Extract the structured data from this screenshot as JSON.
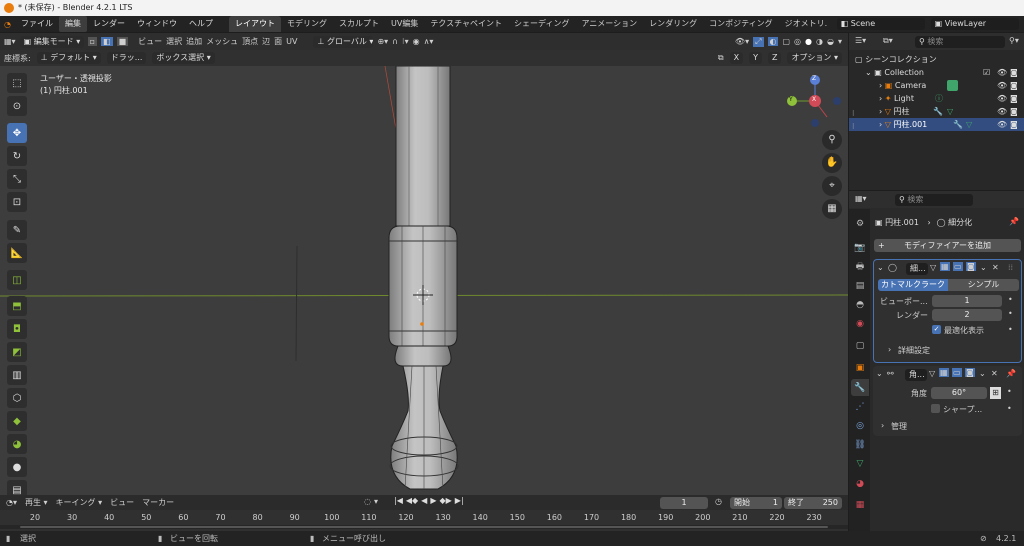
{
  "window": {
    "title": "* (未保存) - Blender 4.2.1 LTS"
  },
  "menubar": {
    "items": [
      "ファイル",
      "編集",
      "レンダー",
      "ウィンドウ",
      "ヘルプ"
    ],
    "workspaces": [
      "レイアウト",
      "モデリング",
      "スカルプト",
      "UV編集",
      "テクスチャペイント",
      "シェーディング",
      "アニメーション",
      "レンダリング",
      "コンポジティング",
      "ジオメトリ."
    ],
    "scene": "Scene",
    "view_layer": "ViewLayer"
  },
  "viewport_header": {
    "mode": "編集モード",
    "menus": [
      "ビュー",
      "選択",
      "追加",
      "メッシュ",
      "頂点",
      "辺",
      "面",
      "UV"
    ],
    "orientation": "グローバル"
  },
  "tool_header": {
    "coord_label": "座標系:",
    "orientation": "デフォルト",
    "drag_label": "ドラッ...",
    "select_box": "ボックス選択",
    "axes": [
      "X",
      "Y",
      "Z"
    ],
    "options": "オプション"
  },
  "viewport": {
    "view_name": "ユーザー・透視投影",
    "object_name": "(1) 円柱.001",
    "gizmo_axes": [
      "Z",
      "Y",
      "X"
    ]
  },
  "outliner": {
    "search_placeholder": "検索",
    "root": "シーンコレクション",
    "collection": "Collection",
    "items": [
      "Camera",
      "Light",
      "円柱",
      "円柱.001"
    ]
  },
  "properties": {
    "search_placeholder": "検索",
    "breadcrumb_object": "円柱.001",
    "breadcrumb_modifier": "細分化",
    "add_modifier": "モディファイアーを追加",
    "subsurf": {
      "name": "細...",
      "type_left": "カトマルクラーク",
      "type_right": "シンプル",
      "viewport_label": "ビューポー...",
      "viewport_value": "1",
      "render_label": "レンダー",
      "render_value": "2",
      "optimal_label": "最適化表示",
      "advanced": "詳細設定"
    },
    "smooth": {
      "name": "角...",
      "angle_label": "角度",
      "angle_value": "60°",
      "sharp_label": "シャープ...",
      "manage": "管理"
    }
  },
  "timeline": {
    "playback": "再生",
    "keying": "キーイング",
    "view": "ビュー",
    "marker": "マーカー",
    "current_frame": "1",
    "start_label": "開始",
    "start": "1",
    "end_label": "終了",
    "end": "250",
    "ruler": [
      "20",
      "30",
      "40",
      "50",
      "60",
      "70",
      "80",
      "90",
      "100",
      "110",
      "120",
      "130",
      "140",
      "150",
      "160",
      "170",
      "180",
      "190",
      "200",
      "210",
      "220",
      "230"
    ]
  },
  "statusbar": {
    "select": "選択",
    "rotate": "ビューを回転",
    "call_menu": "メニュー呼び出し",
    "version": "4.2.1"
  },
  "colors": {
    "accent": "#4772b3",
    "object_orange": "#e87d0d",
    "camera_green": "#3fa56b"
  }
}
